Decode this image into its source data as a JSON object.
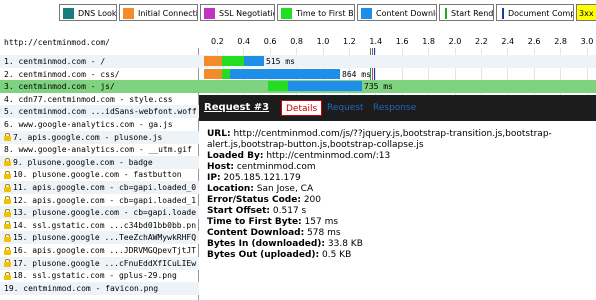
{
  "legend": [
    {
      "label": "DNS Lookup",
      "color": "#1a7d7d"
    },
    {
      "label": "Initial Connection",
      "color": "#f28c28"
    },
    {
      "label": "SSL Negotiation",
      "color": "#c233c2"
    },
    {
      "label": "Time to First Byte",
      "color": "#22dd22"
    },
    {
      "label": "Content Download",
      "color": "#1f8ee8"
    },
    {
      "label": "Start Render",
      "color": "#22aa22"
    },
    {
      "label": "Document Complete",
      "color": "#1a3d99"
    },
    {
      "label": "3xx re",
      "color": "#ffff00"
    }
  ],
  "waterfall": {
    "url_header": "http://centminmod.com/",
    "ticks": [
      "0.2",
      "0.4",
      "0.6",
      "0.8",
      "1.0",
      "1.2",
      "1.4",
      "1.6",
      "1.8",
      "2.0",
      "2.2",
      "2.4",
      "2.6",
      "2.8",
      "3.0"
    ],
    "rows": [
      {
        "label": "1. centminmod.com - /",
        "secure": false,
        "time": "515 ms"
      },
      {
        "label": "2. centminmod.com - css/",
        "secure": false,
        "time": "864 ms"
      },
      {
        "label": "3. centminmod.com - js/",
        "secure": false,
        "time": "735 ms"
      },
      {
        "label": "4. cdn77.centminmod.com - style.css",
        "secure": false,
        "time": ""
      },
      {
        "label": "5. centminmod.com ...idSans-webfont.woff",
        "secure": false,
        "time": ""
      },
      {
        "label": "6. www.google-analytics.com - ga.js",
        "secure": false,
        "time": ""
      },
      {
        "label": "7. apis.google.com - plusone.js",
        "secure": true,
        "time": ""
      },
      {
        "label": "8. www.google-analytics.com - __utm.gif",
        "secure": false,
        "time": ""
      },
      {
        "label": "9. plusone.google.com - badge",
        "secure": true,
        "time": ""
      },
      {
        "label": "10. plusone.google.com - fastbutton",
        "secure": true,
        "time": ""
      },
      {
        "label": "11. apis.google.com - cb=gapi.loaded_0",
        "secure": true,
        "time": ""
      },
      {
        "label": "12. apis.google.com - cb=gapi.loaded_1",
        "secure": true,
        "time": ""
      },
      {
        "label": "13. plusone.google.com - cb=gapi.loaded_0",
        "secure": true,
        "time": ""
      },
      {
        "label": "14. ssl.gstatic.com ...c34bd01bb0bb.png",
        "secure": true,
        "time": ""
      },
      {
        "label": "15. plusone.google ...TeeZchAWMywkRHFQg",
        "secure": true,
        "time": ""
      },
      {
        "label": "16. apis.google.com ...JDRVMGQpevTjtJTQ",
        "secure": true,
        "time": ""
      },
      {
        "label": "17. plusone.google ...cFnuEddXfICuLIEw",
        "secure": true,
        "time": ""
      },
      {
        "label": "18. ssl.gstatic.com - gplus-29.png",
        "secure": true,
        "time": ""
      },
      {
        "label": "19. centminmod.com - favicon.png",
        "secure": false,
        "time": ""
      }
    ]
  },
  "popup": {
    "title": "Request #3",
    "tabs": [
      "Details",
      "Request",
      "Response"
    ],
    "details": [
      {
        "k": "URL:",
        "v": "http://centminmod.com/js/??jquery.js,bootstrap-transition.js,bootstrap-alert.js,bootstrap-button.js,bootstrap-collapse.js"
      },
      {
        "k": "Loaded By:",
        "v": "http://centminmod.com/:13"
      },
      {
        "k": "Host:",
        "v": "centminmod.com"
      },
      {
        "k": "IP:",
        "v": "205.185.121.179"
      },
      {
        "k": "Location:",
        "v": "San Jose, CA"
      },
      {
        "k": "Error/Status Code:",
        "v": "200"
      },
      {
        "k": "Start Offset:",
        "v": "0.517 s"
      },
      {
        "k": "Time to First Byte:",
        "v": "157 ms"
      },
      {
        "k": "Content Download:",
        "v": "578 ms"
      },
      {
        "k": "Bytes In (downloaded):",
        "v": "33.8 KB"
      },
      {
        "k": "Bytes Out (uploaded):",
        "v": "0.5 KB"
      }
    ]
  }
}
